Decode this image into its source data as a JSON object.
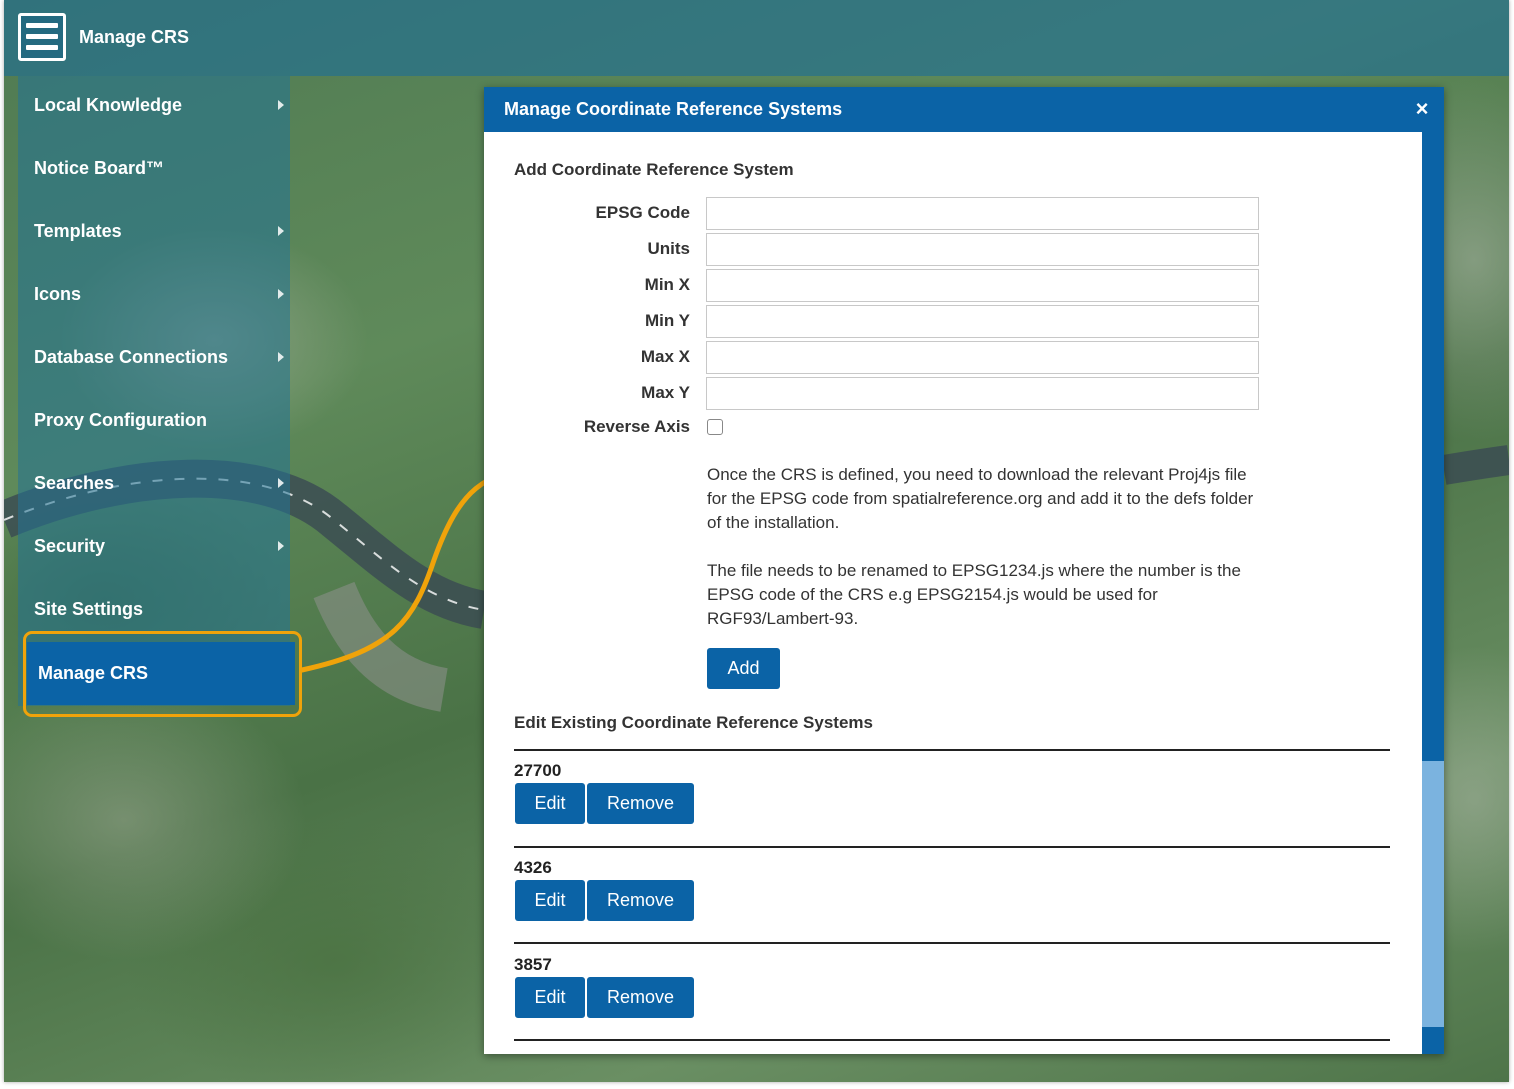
{
  "app": {
    "title": "Manage CRS"
  },
  "sidebar": {
    "items": [
      {
        "label": "Local Knowledge",
        "has_submenu": true
      },
      {
        "label": "Notice Board™",
        "has_submenu": false
      },
      {
        "label": "Templates",
        "has_submenu": true
      },
      {
        "label": "Icons",
        "has_submenu": true
      },
      {
        "label": "Database Connections",
        "has_submenu": true
      },
      {
        "label": "Proxy Configuration",
        "has_submenu": false
      },
      {
        "label": "Searches",
        "has_submenu": true
      },
      {
        "label": "Security",
        "has_submenu": true
      },
      {
        "label": "Site Settings",
        "has_submenu": false
      },
      {
        "label": "Manage CRS",
        "has_submenu": false,
        "active": true
      }
    ]
  },
  "dialog": {
    "title": "Manage Coordinate Reference Systems",
    "close_icon": "×",
    "add_section": {
      "title": "Add Coordinate Reference System",
      "fields": {
        "epsg_code": {
          "label": "EPSG Code",
          "value": ""
        },
        "units": {
          "label": "Units",
          "value": ""
        },
        "min_x": {
          "label": "Min X",
          "value": ""
        },
        "min_y": {
          "label": "Min Y",
          "value": ""
        },
        "max_x": {
          "label": "Max X",
          "value": ""
        },
        "max_y": {
          "label": "Max Y",
          "value": ""
        }
      },
      "reverse_axis": {
        "label": "Reverse Axis",
        "checked": false
      },
      "help_text_1": "Once the CRS is defined, you need to download the relevant Proj4js file for the EPSG code from spatialreference.org and add it to the defs folder of the installation.",
      "help_text_2": "The file needs to be renamed to EPSG1234.js where the number is the EPSG code of the CRS e.g EPSG2154.js would be used for RGF93/Lambert-93.",
      "add_label": "Add"
    },
    "edit_section": {
      "title": "Edit Existing Coordinate Reference Systems",
      "items": [
        {
          "code": "27700",
          "edit_label": "Edit",
          "remove_label": "Remove"
        },
        {
          "code": "4326",
          "edit_label": "Edit",
          "remove_label": "Remove"
        },
        {
          "code": "3857",
          "edit_label": "Edit",
          "remove_label": "Remove"
        }
      ]
    }
  },
  "colors": {
    "primary": "#0b63a6",
    "highlight": "#f0a30a",
    "scroll_thumb": "#7bb3df"
  },
  "icons": {
    "menu": "hamburger-icon",
    "close": "close-icon",
    "submenu": "chevron-right-icon",
    "callout": "arrow-icon"
  }
}
